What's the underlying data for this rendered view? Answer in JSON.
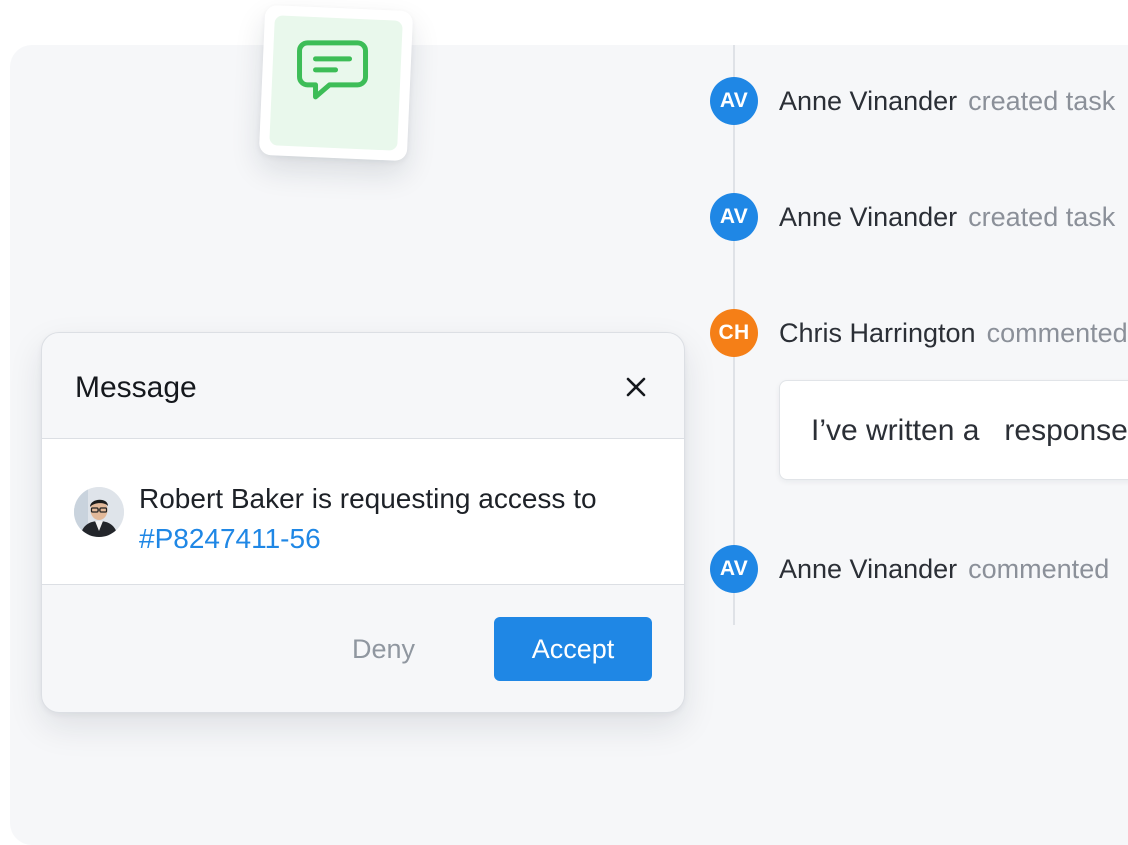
{
  "colors": {
    "accent": "#1f87e5",
    "avatar_blue": "#1f87e5",
    "avatar_orange": "#f57f17",
    "chat_icon_green": "#3dbd57"
  },
  "chat_tile": {
    "icon": "chat-bubble-icon"
  },
  "timeline": {
    "items": [
      {
        "initials": "AV",
        "name": "Anne Vinander",
        "action": "created task",
        "color": "blue"
      },
      {
        "initials": "AV",
        "name": "Anne Vinander",
        "action": "created task",
        "color": "blue"
      },
      {
        "initials": "CH",
        "name": "Chris Harrington",
        "action": "commented",
        "color": "orange"
      },
      {
        "initials": "AV",
        "name": "Anne Vinander",
        "action": "commented",
        "color": "blue"
      }
    ],
    "comment": "I’ve written a   response"
  },
  "dialog": {
    "title": "Message",
    "close_icon": "close-icon",
    "request_text": "Robert Baker is requesting access to",
    "ticket_id": "#P8247411-56",
    "deny_label": "Deny",
    "accept_label": "Accept"
  }
}
